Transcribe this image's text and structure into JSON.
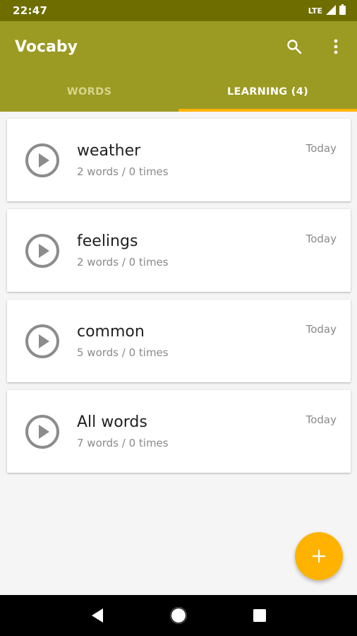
{
  "status_bar": {
    "time": "22:47",
    "network": "LTE",
    "icons": [
      "signal-icon",
      "battery-icon"
    ]
  },
  "app_bar": {
    "title": "Vocaby",
    "actions": [
      "search-icon",
      "more-vert-icon"
    ]
  },
  "tabs": [
    {
      "label": "WORDS",
      "active": false
    },
    {
      "label": "LEARNING (4)",
      "active": true
    }
  ],
  "lists": [
    {
      "name": "weather",
      "summary": "2 words / 0 times",
      "date": "Today"
    },
    {
      "name": "feelings",
      "summary": "2 words / 0 times",
      "date": "Today"
    },
    {
      "name": "common",
      "summary": "5 words / 0 times",
      "date": "Today"
    },
    {
      "name": "All words",
      "summary": "7 words / 0 times",
      "date": "Today"
    }
  ],
  "fab": {
    "icon": "plus-icon"
  },
  "nav_bar": {
    "buttons": [
      "back-icon",
      "home-icon",
      "recents-icon"
    ]
  },
  "colors": {
    "status_bar": "#6e6e00",
    "app_bar": "#9b9a22",
    "accent": "#ffb300",
    "background": "#f5f5f5"
  }
}
